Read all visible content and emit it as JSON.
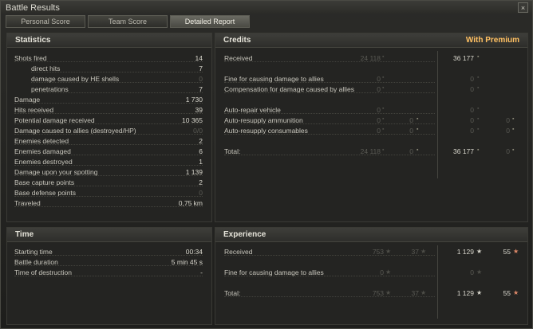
{
  "window": {
    "title": "Battle Results",
    "close": "×"
  },
  "tabs": [
    {
      "label": "Personal Score"
    },
    {
      "label": "Team Score"
    },
    {
      "label": "Detailed Report"
    }
  ],
  "statistics": {
    "title": "Statistics",
    "rows": [
      {
        "label": "Shots fired",
        "value": "14",
        "dim": false
      },
      {
        "label": "direct hits",
        "value": "7",
        "dim": false
      },
      {
        "label": "damage caused by HE shells",
        "value": "0",
        "dim": true
      },
      {
        "label": "penetrations",
        "value": "7",
        "dim": false
      },
      {
        "label": "Damage",
        "value": "1 730",
        "dim": false
      },
      {
        "label": "Hits received",
        "value": "39",
        "dim": false
      },
      {
        "label": "Potential damage received",
        "value": "10 365",
        "dim": false
      },
      {
        "label": "Damage caused to allies (destroyed/HP)",
        "value": "0/0",
        "dim": true
      },
      {
        "label": "Enemies detected",
        "value": "2",
        "dim": false
      },
      {
        "label": "Enemies damaged",
        "value": "6",
        "dim": false
      },
      {
        "label": "Enemies destroyed",
        "value": "1",
        "dim": false
      },
      {
        "label": "Damage upon your spotting",
        "value": "1 139",
        "dim": false
      },
      {
        "label": "Base capture points",
        "value": "2",
        "dim": false
      },
      {
        "label": "Base defense points",
        "value": "0",
        "dim": true
      },
      {
        "label": "Traveled",
        "value": "0,75 km",
        "dim": false
      }
    ]
  },
  "credits": {
    "title": "Credits",
    "premium_title": "With Premium",
    "rows": [
      {
        "label": "Received",
        "v1": "24 118",
        "v2": "",
        "p1": "36 177",
        "p2": "",
        "dim1": true,
        "dimp": false
      },
      {
        "label": "",
        "v1": "",
        "v2": "",
        "p1": "",
        "p2": ""
      },
      {
        "label": "Fine for causing damage to allies",
        "v1": "0",
        "v2": "",
        "p1": "0",
        "p2": "",
        "dim1": true,
        "dimp": true
      },
      {
        "label": "Compensation for damage caused by allies",
        "v1": "0",
        "v2": "",
        "p1": "0",
        "p2": "",
        "dim1": true,
        "dimp": true
      },
      {
        "label": "",
        "v1": "",
        "v2": "",
        "p1": "",
        "p2": ""
      },
      {
        "label": "Auto-repair vehicle",
        "v1": "0",
        "v2": "",
        "p1": "0",
        "p2": "",
        "dim1": true,
        "dimp": true
      },
      {
        "label": "Auto-resupply ammunition",
        "v1": "0",
        "v2": "0",
        "p1": "0",
        "p2": "0",
        "dim1": true,
        "dimp": true
      },
      {
        "label": "Auto-resupply consumables",
        "v1": "0",
        "v2": "0",
        "p1": "0",
        "p2": "0",
        "dim1": true,
        "dimp": true
      },
      {
        "label": "",
        "v1": "",
        "v2": "",
        "p1": "",
        "p2": ""
      },
      {
        "label": "Total:",
        "v1": "24 118",
        "v2": "0",
        "p1": "36 177",
        "p2": "0",
        "dim1": true,
        "dimp": false
      }
    ]
  },
  "time": {
    "title": "Time",
    "rows": [
      {
        "label": "Starting time",
        "value": "00:34"
      },
      {
        "label": "Battle duration",
        "value": "5 min 45 s"
      },
      {
        "label": "Time of destruction",
        "value": "-"
      }
    ]
  },
  "experience": {
    "title": "Experience",
    "rows": [
      {
        "label": "Received",
        "v1": "753",
        "v2": "37",
        "p1": "1 129",
        "p2": "55",
        "dimp": false
      },
      {
        "label": "",
        "v1": "",
        "v2": "",
        "p1": "",
        "p2": ""
      },
      {
        "label": "Fine for causing damage to allies",
        "v1": "0",
        "v2": "",
        "p1": "0",
        "p2": "",
        "dimp": true
      },
      {
        "label": "",
        "v1": "",
        "v2": "",
        "p1": "",
        "p2": ""
      },
      {
        "label": "Total:",
        "v1": "753",
        "v2": "37",
        "p1": "1 129",
        "p2": "55",
        "dimp": false
      }
    ]
  },
  "icons": {
    "credit": "credit-icon",
    "xp": "star-icon",
    "free_xp": "free-xp-star-icon"
  },
  "colors": {
    "premium": "#ffc062",
    "free_xp_star": "#e08a6a"
  }
}
